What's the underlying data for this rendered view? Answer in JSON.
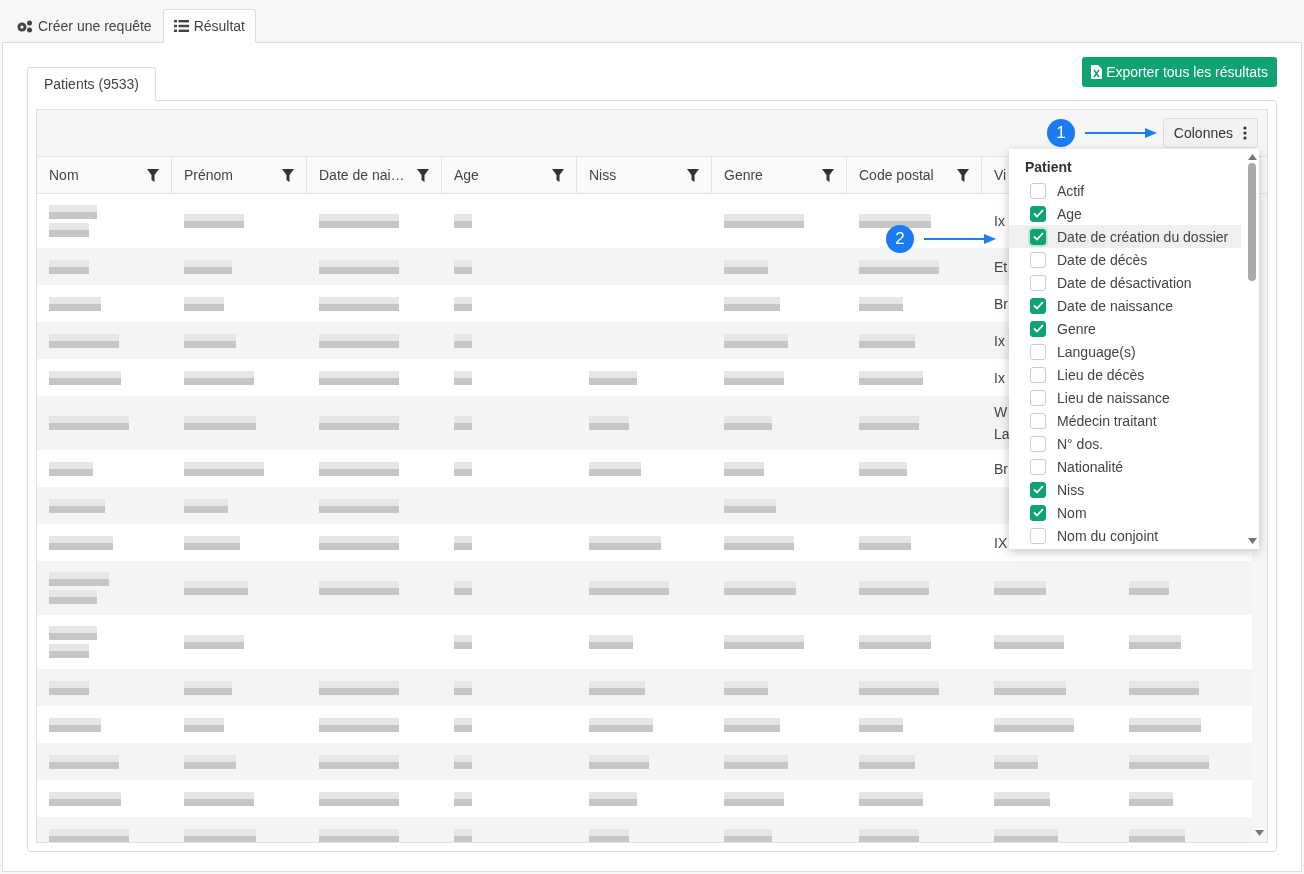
{
  "top_tabs": [
    {
      "label": "Créer une requête",
      "selected": false
    },
    {
      "label": "Résultat",
      "selected": true
    }
  ],
  "export_button": "Exporter tous les résultats",
  "result_tabs": [
    {
      "label": "Patients (9533)",
      "selected": true
    }
  ],
  "columns_button": "Colonnes",
  "columns": [
    {
      "label": "Nom",
      "filter": true
    },
    {
      "label": "Prénom",
      "filter": true
    },
    {
      "label": "Date de nai…",
      "filter": true
    },
    {
      "label": "Age",
      "filter": true
    },
    {
      "label": "Niss",
      "filter": true
    },
    {
      "label": "Genre",
      "filter": true
    },
    {
      "label": "Code postal",
      "filter": true
    },
    {
      "label": "Vi",
      "filter": false
    }
  ],
  "rows": [
    {
      "tall": true,
      "cells": [
        {
          "kind": "blurred2"
        },
        {
          "kind": "blurred"
        },
        {
          "kind": "blurred"
        },
        {
          "kind": "blurred"
        },
        {
          "kind": "empty"
        },
        {
          "kind": "blurred"
        },
        {
          "kind": "blurred"
        },
        {
          "kind": "text",
          "lines": [
            "Ix"
          ]
        },
        {
          "kind": "empty"
        }
      ]
    },
    {
      "tall": false,
      "cells": [
        {
          "kind": "blurred"
        },
        {
          "kind": "blurred"
        },
        {
          "kind": "blurred"
        },
        {
          "kind": "blurred"
        },
        {
          "kind": "empty"
        },
        {
          "kind": "blurred"
        },
        {
          "kind": "blurred"
        },
        {
          "kind": "text",
          "lines": [
            "Et"
          ]
        },
        {
          "kind": "empty"
        }
      ]
    },
    {
      "tall": false,
      "cells": [
        {
          "kind": "blurred"
        },
        {
          "kind": "blurred"
        },
        {
          "kind": "blurred"
        },
        {
          "kind": "blurred"
        },
        {
          "kind": "empty"
        },
        {
          "kind": "blurred"
        },
        {
          "kind": "blurred"
        },
        {
          "kind": "text",
          "lines": [
            "Br"
          ]
        },
        {
          "kind": "empty"
        }
      ]
    },
    {
      "tall": false,
      "cells": [
        {
          "kind": "blurred"
        },
        {
          "kind": "blurred"
        },
        {
          "kind": "blurred"
        },
        {
          "kind": "blurred"
        },
        {
          "kind": "empty"
        },
        {
          "kind": "blurred"
        },
        {
          "kind": "blurred"
        },
        {
          "kind": "text",
          "lines": [
            "Ix"
          ]
        },
        {
          "kind": "empty"
        }
      ]
    },
    {
      "tall": false,
      "cells": [
        {
          "kind": "blurred"
        },
        {
          "kind": "blurred"
        },
        {
          "kind": "blurred"
        },
        {
          "kind": "blurred"
        },
        {
          "kind": "blurred"
        },
        {
          "kind": "blurred"
        },
        {
          "kind": "blurred"
        },
        {
          "kind": "text",
          "lines": [
            "Ix"
          ]
        },
        {
          "kind": "empty"
        }
      ]
    },
    {
      "tall": true,
      "cells": [
        {
          "kind": "blurred"
        },
        {
          "kind": "blurred"
        },
        {
          "kind": "blurred"
        },
        {
          "kind": "blurred"
        },
        {
          "kind": "blurred"
        },
        {
          "kind": "blurred"
        },
        {
          "kind": "blurred"
        },
        {
          "kind": "text",
          "lines": [
            "W",
            "La"
          ]
        },
        {
          "kind": "empty"
        }
      ]
    },
    {
      "tall": false,
      "cells": [
        {
          "kind": "blurred"
        },
        {
          "kind": "blurred"
        },
        {
          "kind": "blurred"
        },
        {
          "kind": "blurred"
        },
        {
          "kind": "blurred"
        },
        {
          "kind": "blurred"
        },
        {
          "kind": "blurred"
        },
        {
          "kind": "text",
          "lines": [
            "Br"
          ]
        },
        {
          "kind": "empty"
        }
      ]
    },
    {
      "tall": false,
      "cells": [
        {
          "kind": "blurred"
        },
        {
          "kind": "blurred"
        },
        {
          "kind": "blurred"
        },
        {
          "kind": "empty"
        },
        {
          "kind": "empty"
        },
        {
          "kind": "blurred"
        },
        {
          "kind": "empty"
        },
        {
          "kind": "empty"
        },
        {
          "kind": "empty"
        }
      ]
    },
    {
      "tall": false,
      "cells": [
        {
          "kind": "blurred"
        },
        {
          "kind": "blurred"
        },
        {
          "kind": "blurred"
        },
        {
          "kind": "blurred"
        },
        {
          "kind": "blurred"
        },
        {
          "kind": "blurred"
        },
        {
          "kind": "blurred"
        },
        {
          "kind": "text",
          "lines": [
            "IX"
          ]
        },
        {
          "kind": "empty"
        }
      ]
    },
    {
      "tall": true,
      "cells": [
        {
          "kind": "blurred2"
        },
        {
          "kind": "blurred"
        },
        {
          "kind": "blurred"
        },
        {
          "kind": "blurred"
        },
        {
          "kind": "blurred"
        },
        {
          "kind": "blurred"
        },
        {
          "kind": "blurred"
        },
        {
          "kind": "blurred"
        },
        {
          "kind": "blurred"
        }
      ]
    },
    {
      "tall": true,
      "cells": [
        {
          "kind": "blurred2"
        },
        {
          "kind": "blurred"
        },
        {
          "kind": "empty"
        },
        {
          "kind": "blurred"
        },
        {
          "kind": "blurred"
        },
        {
          "kind": "blurred"
        },
        {
          "kind": "blurred"
        },
        {
          "kind": "blurred"
        },
        {
          "kind": "blurred"
        }
      ]
    },
    {
      "tall": false,
      "cells": [
        {
          "kind": "blurred"
        },
        {
          "kind": "blurred"
        },
        {
          "kind": "blurred"
        },
        {
          "kind": "blurred"
        },
        {
          "kind": "blurred"
        },
        {
          "kind": "blurred"
        },
        {
          "kind": "blurred"
        },
        {
          "kind": "blurred"
        },
        {
          "kind": "blurred"
        }
      ]
    },
    {
      "tall": false,
      "cells": [
        {
          "kind": "blurred"
        },
        {
          "kind": "blurred"
        },
        {
          "kind": "blurred"
        },
        {
          "kind": "blurred"
        },
        {
          "kind": "blurred"
        },
        {
          "kind": "blurred"
        },
        {
          "kind": "blurred"
        },
        {
          "kind": "blurred"
        },
        {
          "kind": "blurred"
        }
      ]
    },
    {
      "tall": false,
      "cells": [
        {
          "kind": "blurred"
        },
        {
          "kind": "blurred"
        },
        {
          "kind": "blurred"
        },
        {
          "kind": "blurred"
        },
        {
          "kind": "blurred"
        },
        {
          "kind": "blurred"
        },
        {
          "kind": "blurred"
        },
        {
          "kind": "blurred"
        },
        {
          "kind": "blurred"
        }
      ]
    },
    {
      "tall": false,
      "cells": [
        {
          "kind": "blurred"
        },
        {
          "kind": "blurred"
        },
        {
          "kind": "blurred"
        },
        {
          "kind": "blurred"
        },
        {
          "kind": "blurred"
        },
        {
          "kind": "blurred"
        },
        {
          "kind": "blurred"
        },
        {
          "kind": "blurred"
        },
        {
          "kind": "blurred"
        }
      ]
    },
    {
      "tall": false,
      "cells": [
        {
          "kind": "blurred"
        },
        {
          "kind": "blurred"
        },
        {
          "kind": "blurred"
        },
        {
          "kind": "blurred"
        },
        {
          "kind": "blurred"
        },
        {
          "kind": "blurred"
        },
        {
          "kind": "blurred"
        },
        {
          "kind": "blurred"
        },
        {
          "kind": "blurred"
        }
      ]
    }
  ],
  "column_menu": {
    "group": "Patient",
    "items": [
      {
        "label": "Actif",
        "checked": false,
        "highlighted": false
      },
      {
        "label": "Age",
        "checked": true,
        "highlighted": false
      },
      {
        "label": "Date de création du dossier",
        "checked": true,
        "highlighted": true
      },
      {
        "label": "Date de décès",
        "checked": false,
        "highlighted": false
      },
      {
        "label": "Date de désactivation",
        "checked": false,
        "highlighted": false
      },
      {
        "label": "Date de naissance",
        "checked": true,
        "highlighted": false
      },
      {
        "label": "Genre",
        "checked": true,
        "highlighted": false
      },
      {
        "label": "Language(s)",
        "checked": false,
        "highlighted": false
      },
      {
        "label": "Lieu de décès",
        "checked": false,
        "highlighted": false
      },
      {
        "label": "Lieu de naissance",
        "checked": false,
        "highlighted": false
      },
      {
        "label": "Médecin traitant",
        "checked": false,
        "highlighted": false
      },
      {
        "label": "N° dos.",
        "checked": false,
        "highlighted": false
      },
      {
        "label": "Nationalité",
        "checked": false,
        "highlighted": false
      },
      {
        "label": "Niss",
        "checked": true,
        "highlighted": false
      },
      {
        "label": "Nom",
        "checked": true,
        "highlighted": false
      },
      {
        "label": "Nom du conjoint",
        "checked": false,
        "highlighted": false
      }
    ]
  },
  "callouts": [
    {
      "number": "1"
    },
    {
      "number": "2"
    }
  ]
}
